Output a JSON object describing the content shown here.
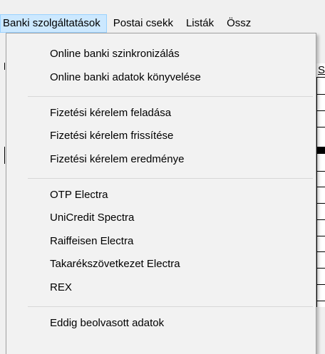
{
  "menubar": {
    "items": [
      {
        "label": "Banki szolgáltatások",
        "active": true
      },
      {
        "label": "Postai csekk"
      },
      {
        "label": "Listák"
      },
      {
        "label": "Össz"
      }
    ]
  },
  "background_grid": {
    "header_text": "S"
  },
  "dropdown": {
    "groups": [
      [
        "Online banki szinkronizálás",
        "Online banki adatok könyvelése"
      ],
      [
        "Fizetési kérelem feladása",
        "Fizetési kérelem frissítése",
        "Fizetési kérelem eredménye"
      ],
      [
        "OTP Electra",
        "UniCredit Spectra",
        "Raiffeisen Electra",
        "Takarékszövetkezet Electra",
        "REX"
      ],
      [
        "Eddig beolvasott adatok"
      ]
    ]
  },
  "colors": {
    "menu_bg": "#f2f2f2",
    "highlight": "#cce8ff",
    "highlight_border": "#99d1ff",
    "separator": "#d7d7d7"
  }
}
